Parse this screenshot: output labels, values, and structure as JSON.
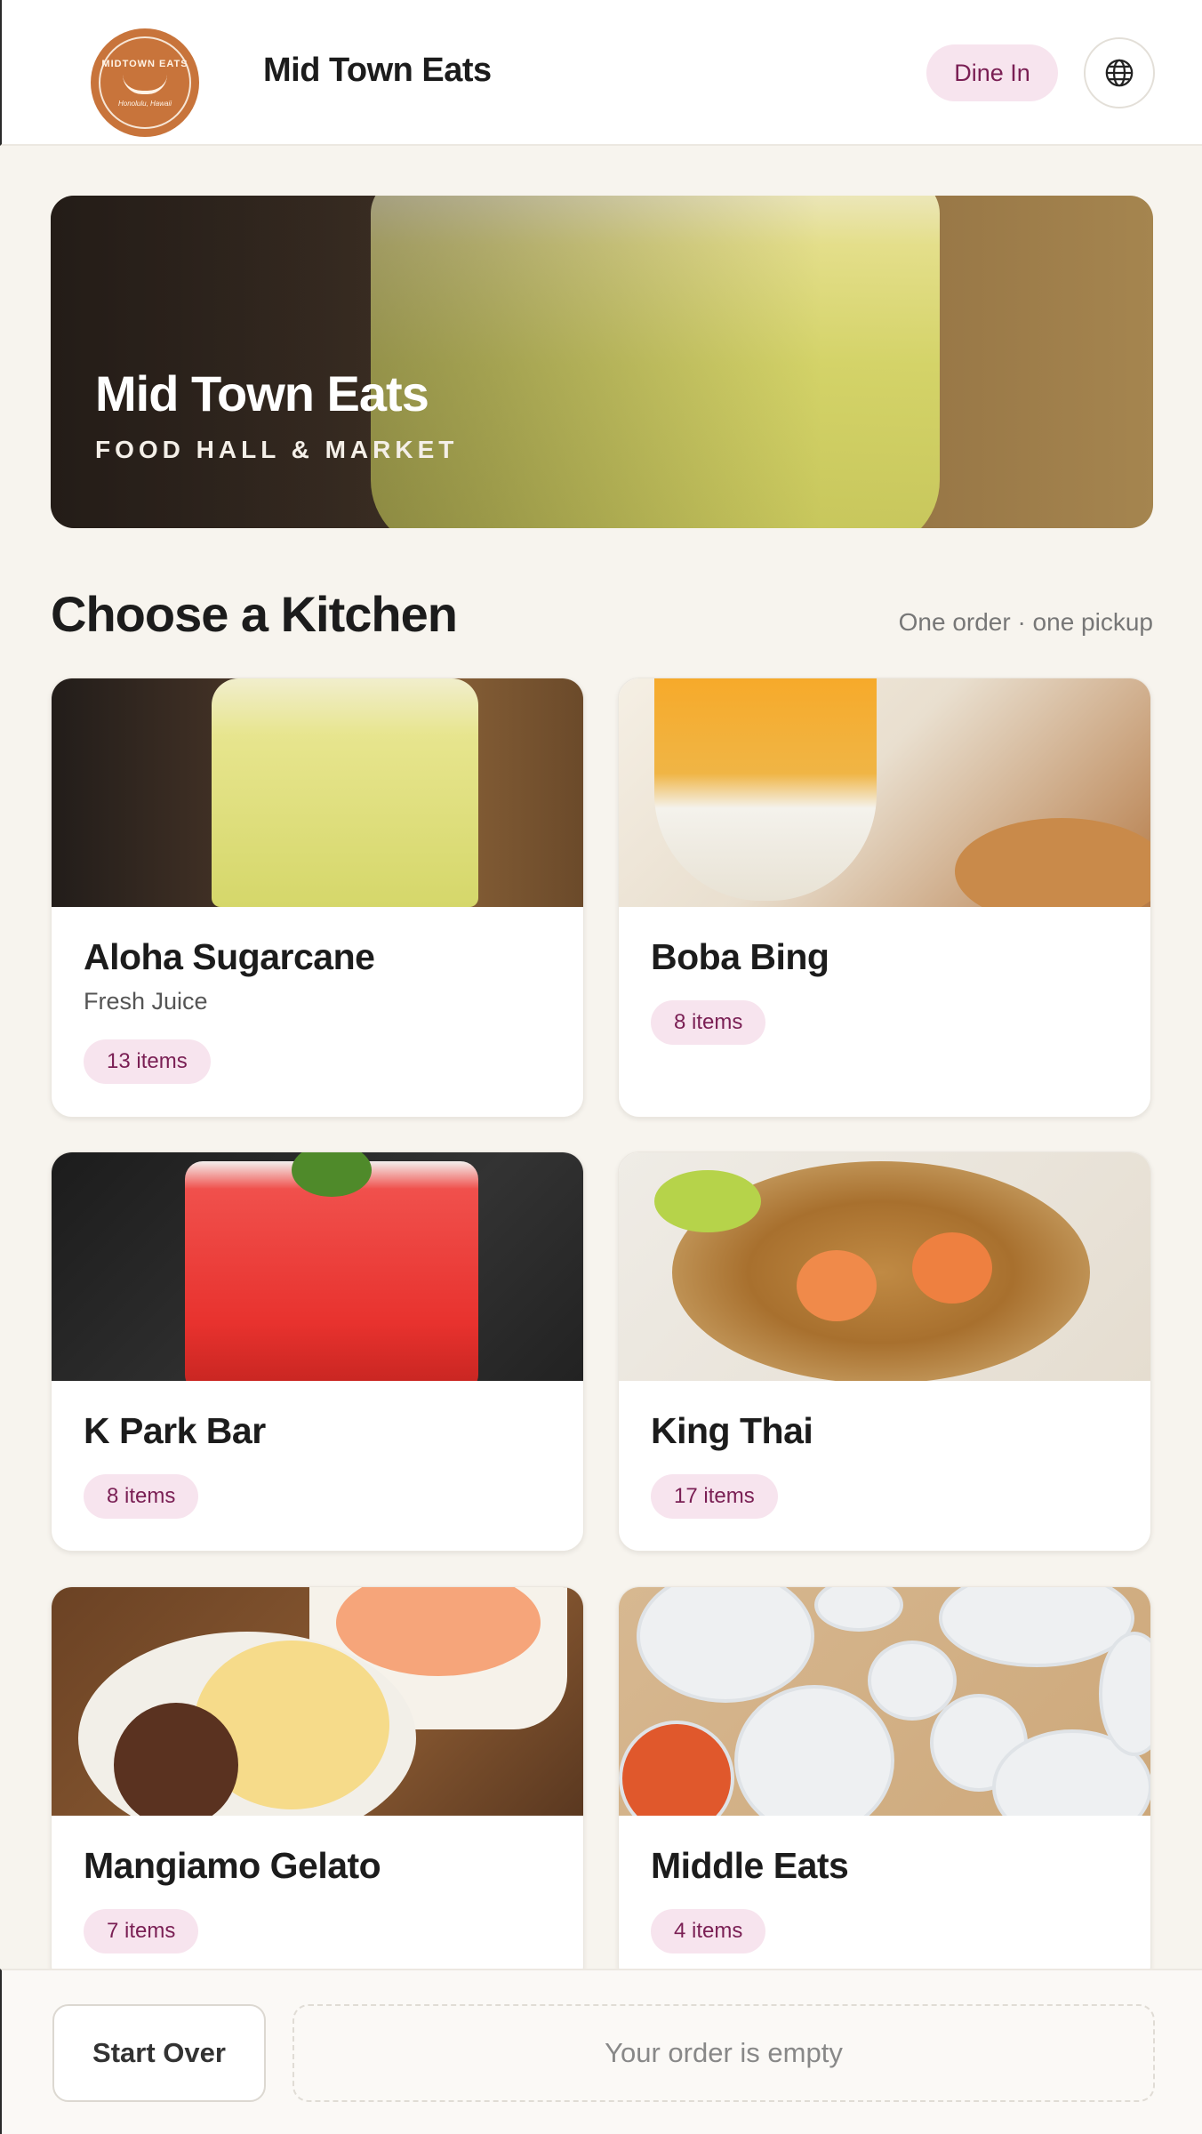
{
  "header": {
    "logo_text_top": "MIDTOWN EATS",
    "logo_text_bottom": "Honolulu, Hawaii",
    "title": "Mid Town Eats",
    "dine_in_label": "Dine In",
    "language_icon": "globe-icon"
  },
  "hero": {
    "title": "Mid Town Eats",
    "subtitle": "FOOD HALL & MARKET"
  },
  "section": {
    "title": "Choose a Kitchen",
    "note": "One order · one pickup"
  },
  "kitchens": [
    {
      "name": "Aloha Sugarcane",
      "description": "Fresh Juice",
      "count": "13 items"
    },
    {
      "name": "Boba Bing",
      "description": "",
      "count": "8 items"
    },
    {
      "name": "K Park Bar",
      "description": "",
      "count": "8 items"
    },
    {
      "name": "King Thai",
      "description": "",
      "count": "17 items"
    },
    {
      "name": "Mangiamo Gelato",
      "description": "",
      "count": "7 items"
    },
    {
      "name": "Middle Eats",
      "description": "",
      "count": "4 items"
    }
  ],
  "footer": {
    "start_over_label": "Start Over",
    "order_status": "Your order is empty"
  },
  "colors": {
    "accent_badge_bg": "#f7e4ee",
    "accent_badge_text": "#7a1f54",
    "logo_orange": "#c8743b",
    "page_bg": "#f7f4ee"
  }
}
